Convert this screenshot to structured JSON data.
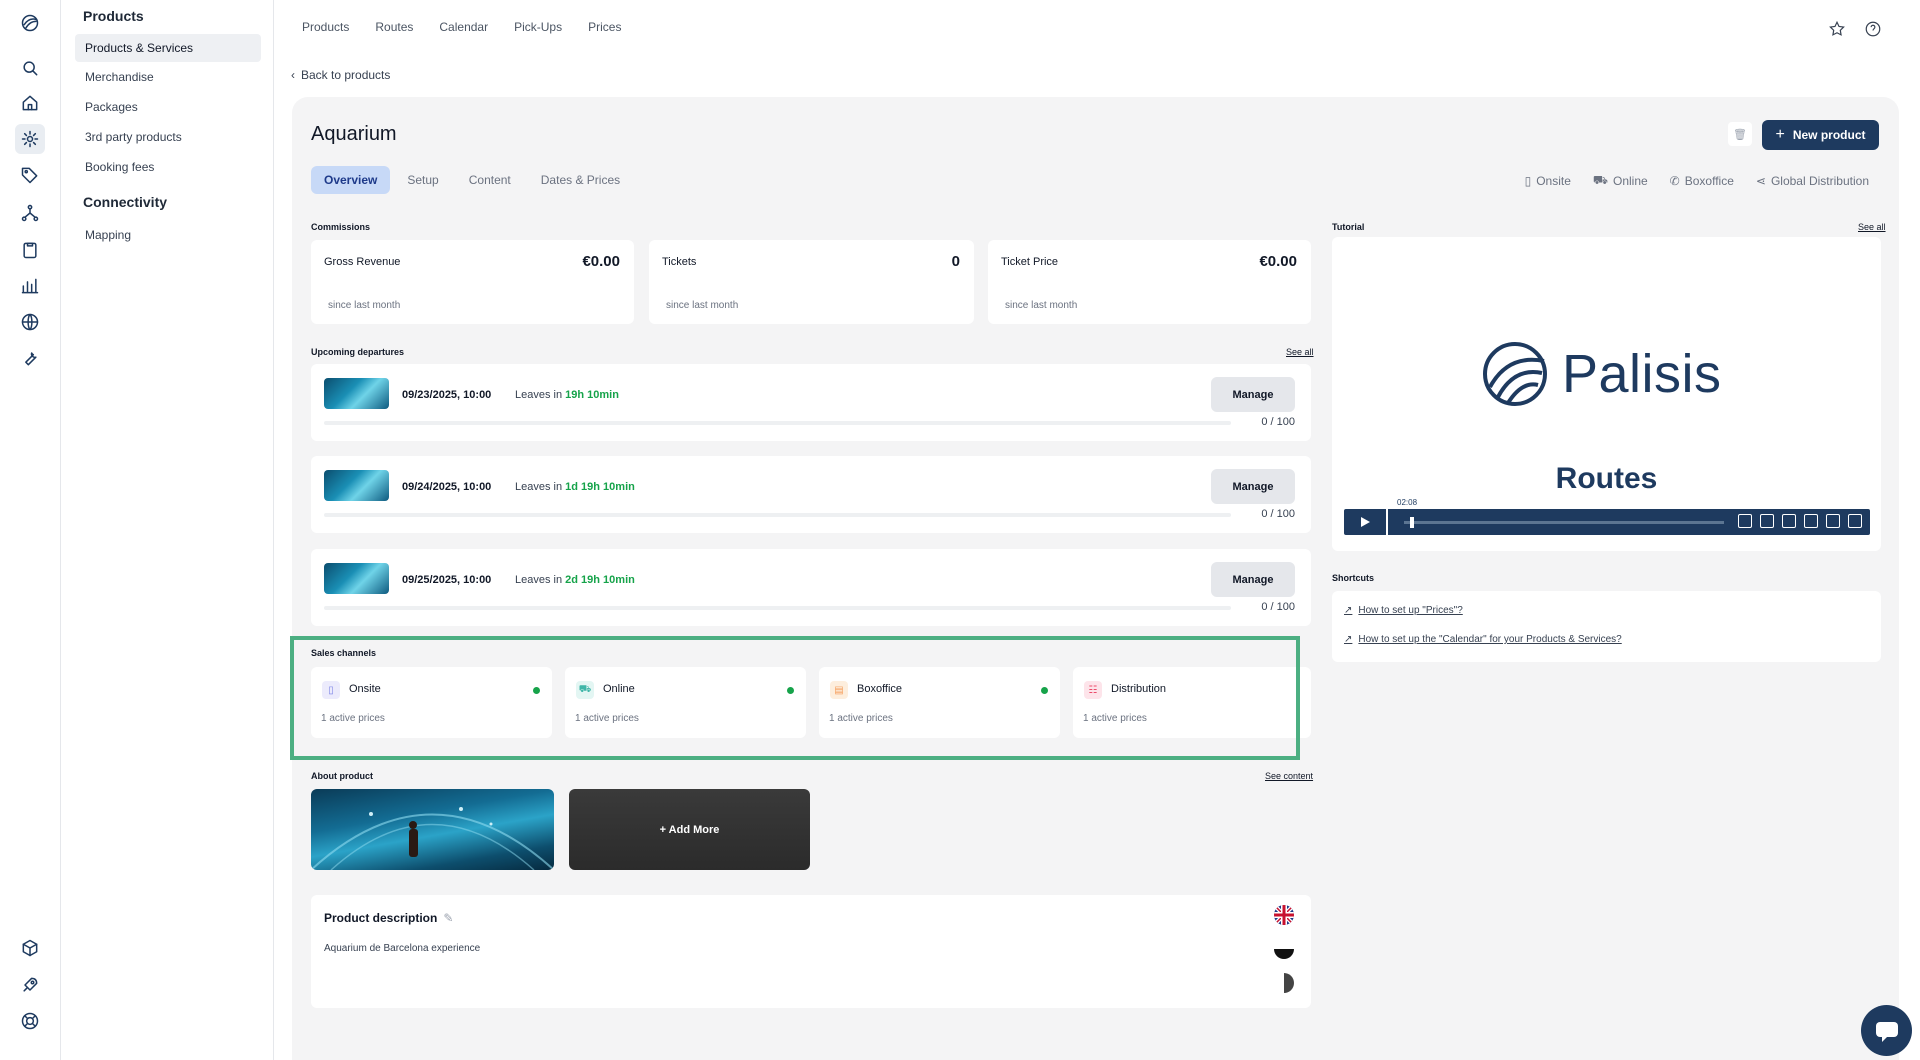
{
  "icons": {
    "rail": [
      "logo-icon",
      "search-icon",
      "home-icon",
      "settings-icon",
      "tag-icon",
      "network-icon",
      "clipboard-icon",
      "bar-chart-icon",
      "globe-icon",
      "wrench-icon",
      "cube-icon",
      "rocket-icon",
      "lifebuoy-icon"
    ],
    "top": [
      "star-icon",
      "help-icon"
    ]
  },
  "sidebar": {
    "section1": "Products",
    "items1": [
      "Products & Services",
      "Merchandise",
      "Packages",
      "3rd party products",
      "Booking fees"
    ],
    "section2": "Connectivity",
    "items2": [
      "Mapping"
    ]
  },
  "topnav": [
    "Products",
    "Routes",
    "Calendar",
    "Pick-Ups",
    "Prices"
  ],
  "back_label": "Back to products",
  "product": {
    "title": "Aquarium",
    "new_button": "New product",
    "tabs": [
      "Overview",
      "Setup",
      "Content",
      "Dates & Prices"
    ],
    "channel_links": [
      "Onsite",
      "Online",
      "Boxoffice",
      "Global Distribution"
    ]
  },
  "commissions": {
    "label": "Commissions",
    "cards": [
      {
        "name": "Gross Revenue",
        "value": "€0.00",
        "sub": "since last month"
      },
      {
        "name": "Tickets",
        "value": "0",
        "sub": "since last month"
      },
      {
        "name": "Ticket Price",
        "value": "€0.00",
        "sub": "since last month"
      }
    ]
  },
  "departures": {
    "label": "Upcoming departures",
    "see_all": "See all",
    "items": [
      {
        "date": "09/23/2025, 10:00",
        "leaves_prefix": "Leaves in",
        "leaves": "19h 10min",
        "manage": "Manage",
        "capacity": "0 / 100",
        "fill": 0
      },
      {
        "date": "09/24/2025, 10:00",
        "leaves_prefix": "Leaves in",
        "leaves": "1d 19h 10min",
        "manage": "Manage",
        "capacity": "0 / 100",
        "fill": 0
      },
      {
        "date": "09/25/2025, 10:00",
        "leaves_prefix": "Leaves in",
        "leaves": "2d 19h 10min",
        "manage": "Manage",
        "capacity": "0 / 100",
        "fill": 0
      }
    ]
  },
  "sales_channels": {
    "label": "Sales channels",
    "items": [
      {
        "name": "Onsite",
        "count": "1 active prices",
        "active": true,
        "color": "#7c83e6"
      },
      {
        "name": "Online",
        "count": "1 active prices",
        "active": true,
        "color": "#3fb6a8"
      },
      {
        "name": "Boxoffice",
        "count": "1 active prices",
        "active": true,
        "color": "#f59e5b"
      },
      {
        "name": "Distribution",
        "count": "1 active prices",
        "active": false,
        "color": "#ec4b6b"
      }
    ]
  },
  "about": {
    "label": "About product",
    "see_content": "See content",
    "add_more": "+ Add More"
  },
  "description": {
    "title": "Product description",
    "text": "Aquarium de Barcelona experience"
  },
  "tutorial": {
    "label": "Tutorial",
    "see_all": "See all",
    "brand": "Palisis",
    "subtitle": "Routes",
    "time": "02:08",
    "progress": 0.02
  },
  "shortcuts": {
    "label": "Shortcuts",
    "links": [
      "How to set up \"Prices\"?",
      "How to set up the \"Calendar\" for your Products & Services?"
    ]
  },
  "colors": {
    "accent": "#1e3a5f",
    "green": "#16a34a",
    "highlight": "#4caf82"
  }
}
